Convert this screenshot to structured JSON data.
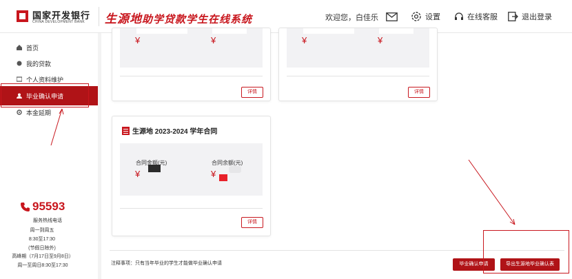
{
  "header": {
    "bank_name_cn": "国家开发银行",
    "bank_name_en": "CHINA DEVELOPMENT BANK",
    "system_title_prefix": "生源地",
    "system_title_rest": "助学贷款学生在线系统",
    "welcome": "欢迎您，白佳乐",
    "settings_label": "设置",
    "service_label": "在线客服",
    "logout_label": "退出登录"
  },
  "sidebar": {
    "items": [
      {
        "label": "首页",
        "icon": "home-icon"
      },
      {
        "label": "我的贷款",
        "icon": "loan-icon"
      },
      {
        "label": "个人资料维护",
        "icon": "profile-icon"
      },
      {
        "label": "毕业确认申请",
        "icon": "user-icon"
      },
      {
        "label": "本金延期",
        "icon": "gear-icon"
      }
    ],
    "active_index": 3,
    "hotline": "95593",
    "hotline_label": "服务热线电话",
    "days": "周一到周五",
    "hours": "8:30至17:30",
    "holiday_note": "(节假日除外)",
    "peak_period": "高峰期（7月17日至9月8日）",
    "peak_hours": "周一至周日8:30至17:30"
  },
  "cards": {
    "card1": {
      "yen1": "¥",
      "yen2": "¥",
      "detail_label": "详情"
    },
    "card2": {
      "yen1": "¥",
      "yen2": "¥",
      "detail_label": "详情"
    },
    "card3": {
      "title": "生源地 2023-2024 学年合同",
      "amount_label": "合同金额(元)",
      "balance_label": "合同余额(元)",
      "yen1": "¥",
      "yen2": "¥",
      "detail_label": "详情"
    }
  },
  "footer": {
    "note": "注释事项：只有当年毕业的学生才能做毕业确认申请",
    "confirm_button": "毕业确认申请",
    "export_button": "导出生源地毕业确认表"
  },
  "colors": {
    "brand_red": "#c8161d",
    "active_red": "#b01317"
  }
}
